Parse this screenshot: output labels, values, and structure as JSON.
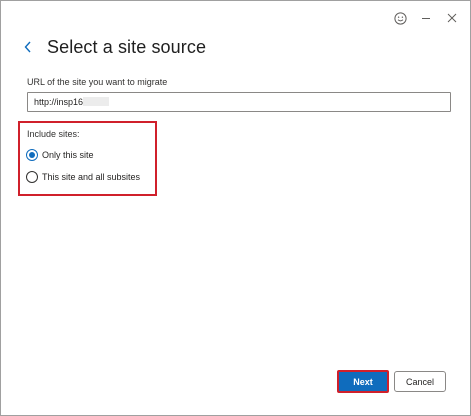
{
  "window": {
    "controls": [
      {
        "icon": "smiley-feedback-icon"
      },
      {
        "icon": "minimize-icon"
      },
      {
        "icon": "close-icon"
      }
    ]
  },
  "header": {
    "back_icon": "chevron-left-icon",
    "title": "Select a site source"
  },
  "url_field": {
    "label": "URL of the site you want to migrate",
    "value": "http://insp16:"
  },
  "include_sites": {
    "label": "Include sites:",
    "options": [
      {
        "label": "Only this site",
        "selected": true
      },
      {
        "label": "This site and all subsites",
        "selected": false
      }
    ],
    "highlight_color": "#d0202b"
  },
  "footer": {
    "next_label": "Next",
    "cancel_label": "Cancel"
  },
  "colors": {
    "accent": "#0f6cbd",
    "highlight": "#d0202b"
  }
}
